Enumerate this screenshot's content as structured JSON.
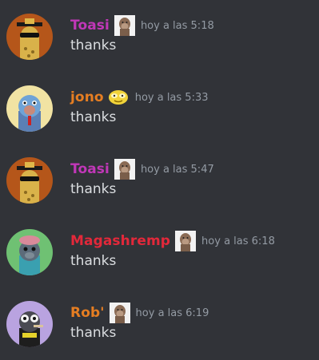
{
  "messages": [
    {
      "username": "Toasi",
      "name_color": "#c137b8",
      "avatar_icon": "ape-avatar-gold-hat-icon",
      "badge_icon": "ape-badge-icon",
      "timestamp": "hoy a las 5:18",
      "content": "thanks"
    },
    {
      "username": "jono",
      "name_color": "#e67e22",
      "avatar_icon": "ape-avatar-blue-fur-icon",
      "badge_icon": "face-emoji-icon",
      "timestamp": "hoy a las 5:33",
      "content": "thanks"
    },
    {
      "username": "Toasi",
      "name_color": "#c137b8",
      "avatar_icon": "ape-avatar-gold-hat-icon",
      "badge_icon": "ape-badge-icon",
      "timestamp": "hoy a las 5:47",
      "content": "thanks"
    },
    {
      "username": "Magashremp",
      "name_color": "#e3283a",
      "avatar_icon": "ape-avatar-green-bg-icon",
      "badge_icon": "ape-badge-icon",
      "timestamp": "hoy a las 6:18",
      "content": "thanks"
    },
    {
      "username": "Rob'",
      "name_color": "#e67e22",
      "avatar_icon": "ape-avatar-purple-bg-icon",
      "badge_icon": "ape-badge-icon",
      "timestamp": "hoy a las 6:19",
      "content": "thanks"
    }
  ]
}
